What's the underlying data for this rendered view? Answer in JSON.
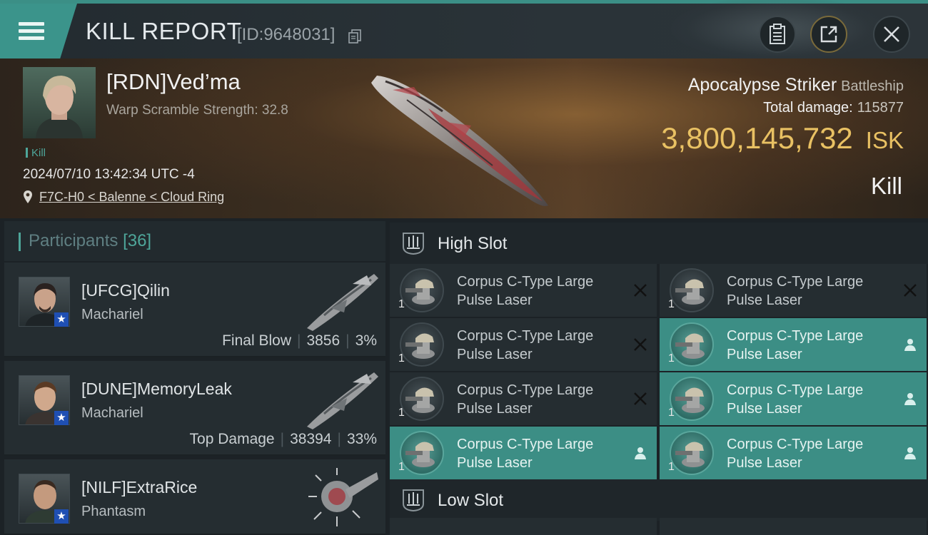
{
  "header": {
    "title": "KILL REPORT",
    "report_id": "[ID:9648031]",
    "menu_icon": "hamburger-menu-icon",
    "buttons": [
      "clipboard-icon",
      "share-icon",
      "close-icon"
    ]
  },
  "victim": {
    "name": "[RDN]Ved’ma",
    "warp_scramble": "Warp Scramble Strength: 32.8",
    "tag": "Kill",
    "datetime": "2024/07/10 13:42:34 UTC -4",
    "location": "F7C-H0 < Balenne < Cloud Ring",
    "ship_name": "Apocalypse Striker",
    "ship_class": "Battleship",
    "total_damage_label": "Total damage:",
    "total_damage": "115877",
    "isk_value": "3,800,145,732",
    "isk_unit": "ISK",
    "result": "Kill"
  },
  "participants": {
    "label": "Participants",
    "count": "[36]",
    "items": [
      {
        "name": "[UFCG]Qilin",
        "ship": "Machariel",
        "role": "Final Blow",
        "damage": "3856",
        "percent": "3%"
      },
      {
        "name": "[DUNE]MemoryLeak",
        "ship": "Machariel",
        "role": "Top Damage",
        "damage": "38394",
        "percent": "33%"
      },
      {
        "name": "[NILF]ExtraRice",
        "ship": "Phantasm",
        "role": "",
        "damage": "",
        "percent": ""
      }
    ]
  },
  "fitting": {
    "high_slot_label": "High Slot",
    "low_slot_label": "Low Slot",
    "high_modules": [
      {
        "line1": "Corpus C-Type Large",
        "line2": "Pulse Laser",
        "qty": "1",
        "status": "destroyed"
      },
      {
        "line1": "Corpus C-Type Large",
        "line2": "Pulse Laser",
        "qty": "1",
        "status": "destroyed"
      },
      {
        "line1": "Corpus C-Type Large",
        "line2": "Pulse Laser",
        "qty": "1",
        "status": "destroyed"
      },
      {
        "line1": "Corpus C-Type Large",
        "line2": "Pulse Laser",
        "qty": "1",
        "status": "dropped"
      },
      {
        "line1": "Corpus C-Type Large",
        "line2": "Pulse Laser",
        "qty": "1",
        "status": "destroyed"
      },
      {
        "line1": "Corpus C-Type Large",
        "line2": "Pulse Laser",
        "qty": "1",
        "status": "dropped"
      },
      {
        "line1": "Corpus C-Type Large",
        "line2": "Pulse Laser",
        "qty": "1",
        "status": "dropped"
      },
      {
        "line1": "Corpus C-Type Large",
        "line2": "Pulse Laser",
        "qty": "1",
        "status": "dropped"
      }
    ]
  },
  "colors": {
    "accent_teal": "#3b948b",
    "isk_gold": "#e9c163",
    "panel_bg": "#252d31"
  }
}
